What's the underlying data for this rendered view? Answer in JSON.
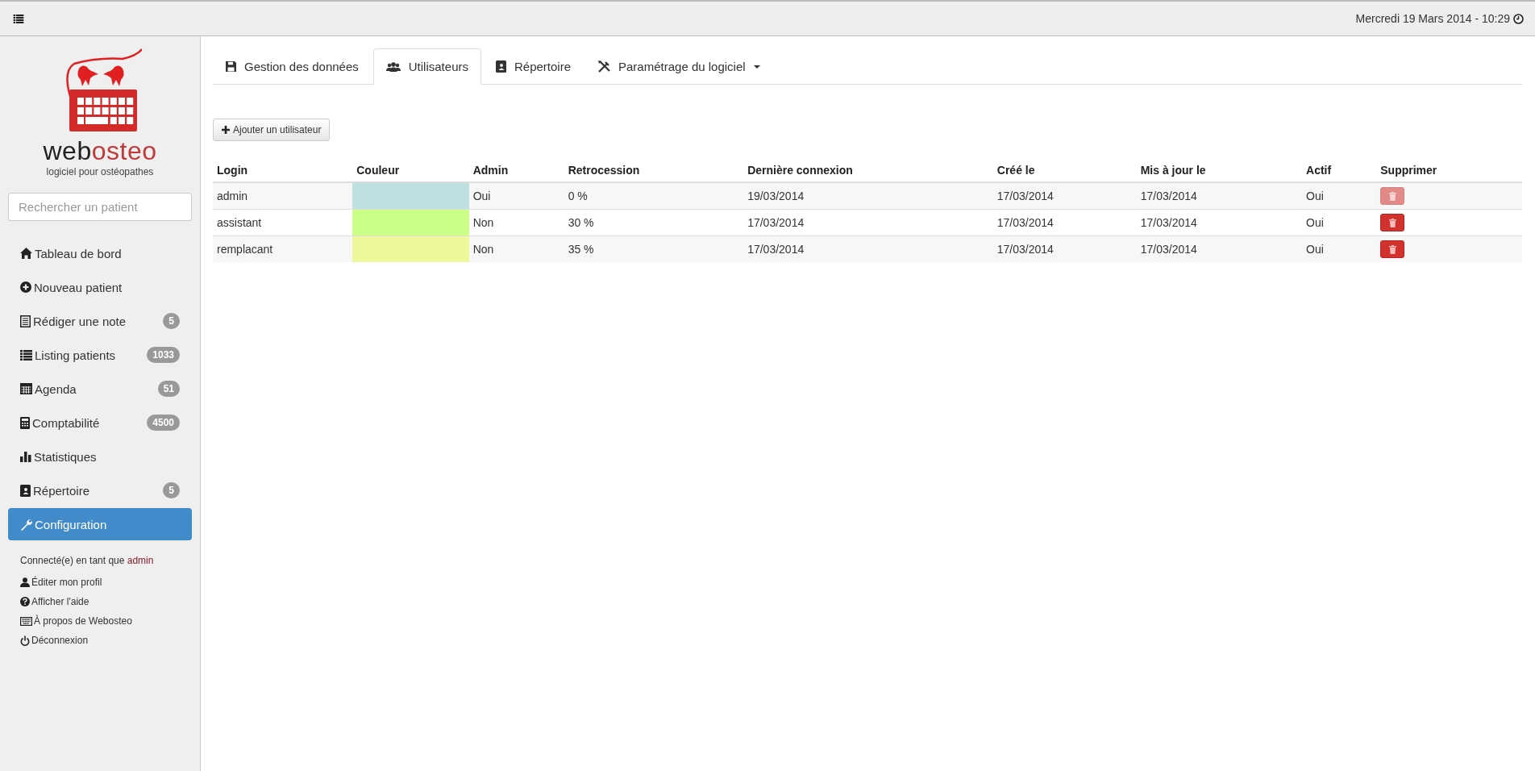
{
  "topbar": {
    "datetime": "Mercredi 19 Mars 2014 - 10:29"
  },
  "sidebar": {
    "logo": {
      "word_start": "web",
      "word_end": "osteo",
      "tagline": "logiciel pour ostéopathes"
    },
    "search": {
      "placeholder": "Rechercher un patient"
    },
    "items": [
      {
        "kind": "home",
        "label": "Tableau de bord",
        "selected": false
      },
      {
        "kind": "plus",
        "label": "Nouveau patient",
        "selected": false
      },
      {
        "kind": "note",
        "label": "Rédiger une note",
        "badge": "5",
        "selected": false
      },
      {
        "kind": "list",
        "label": "Listing patients",
        "badge": "1033",
        "selected": false
      },
      {
        "kind": "calendar",
        "label": "Agenda",
        "badge": "51",
        "selected": false
      },
      {
        "kind": "calculator",
        "label": "Comptabilité",
        "badge": "4500",
        "selected": false
      },
      {
        "kind": "chart",
        "label": "Statistiques",
        "selected": false
      },
      {
        "kind": "book",
        "label": "Répertoire",
        "badge": "5",
        "selected": false
      },
      {
        "kind": "wrench",
        "label": "Configuration",
        "selected": true
      }
    ],
    "account": {
      "connected_as": "Connecté(e) en tant que",
      "user": "admin",
      "links": [
        {
          "kind": "user",
          "label": "Éditer mon profil"
        },
        {
          "kind": "help",
          "label": "Afficher l'aide"
        },
        {
          "kind": "keyboard",
          "label": "À propos de Webosteo"
        },
        {
          "kind": "power",
          "label": "Déconnexion"
        }
      ]
    }
  },
  "tabs": [
    {
      "kind": "save",
      "label": "Gestion des données",
      "selected": false,
      "has_menu": false
    },
    {
      "kind": "users",
      "label": "Utilisateurs",
      "selected": true,
      "has_menu": false
    },
    {
      "kind": "book",
      "label": "Répertoire",
      "selected": false,
      "has_menu": false
    },
    {
      "kind": "tools",
      "label": "Paramétrage du logiciel",
      "selected": false,
      "has_menu": true
    }
  ],
  "add_button": "Ajouter un utilisateur",
  "table": {
    "columns": [
      "Login",
      "Couleur",
      "Admin",
      "Retrocession",
      "Dernière connexion",
      "Créé le",
      "Mis à jour le",
      "Actif",
      "Supprimer"
    ],
    "rows": [
      {
        "login": "admin",
        "color": "#bfe0e0",
        "admin": "Oui",
        "retrocession": "0 %",
        "last_login": "19/03/2014",
        "created": "17/03/2014",
        "updated": "17/03/2014",
        "active": "Oui",
        "delete_disabled": true
      },
      {
        "login": "assistant",
        "color": "#ccff88",
        "admin": "Non",
        "retrocession": "30 %",
        "last_login": "17/03/2014",
        "created": "17/03/2014",
        "updated": "17/03/2014",
        "active": "Oui",
        "delete_disabled": false
      },
      {
        "login": "remplacant",
        "color": "#eef799",
        "admin": "Non",
        "retrocession": "35 %",
        "last_login": "17/03/2014",
        "created": "17/03/2014",
        "updated": "17/03/2014",
        "active": "Oui",
        "delete_disabled": false
      }
    ]
  }
}
